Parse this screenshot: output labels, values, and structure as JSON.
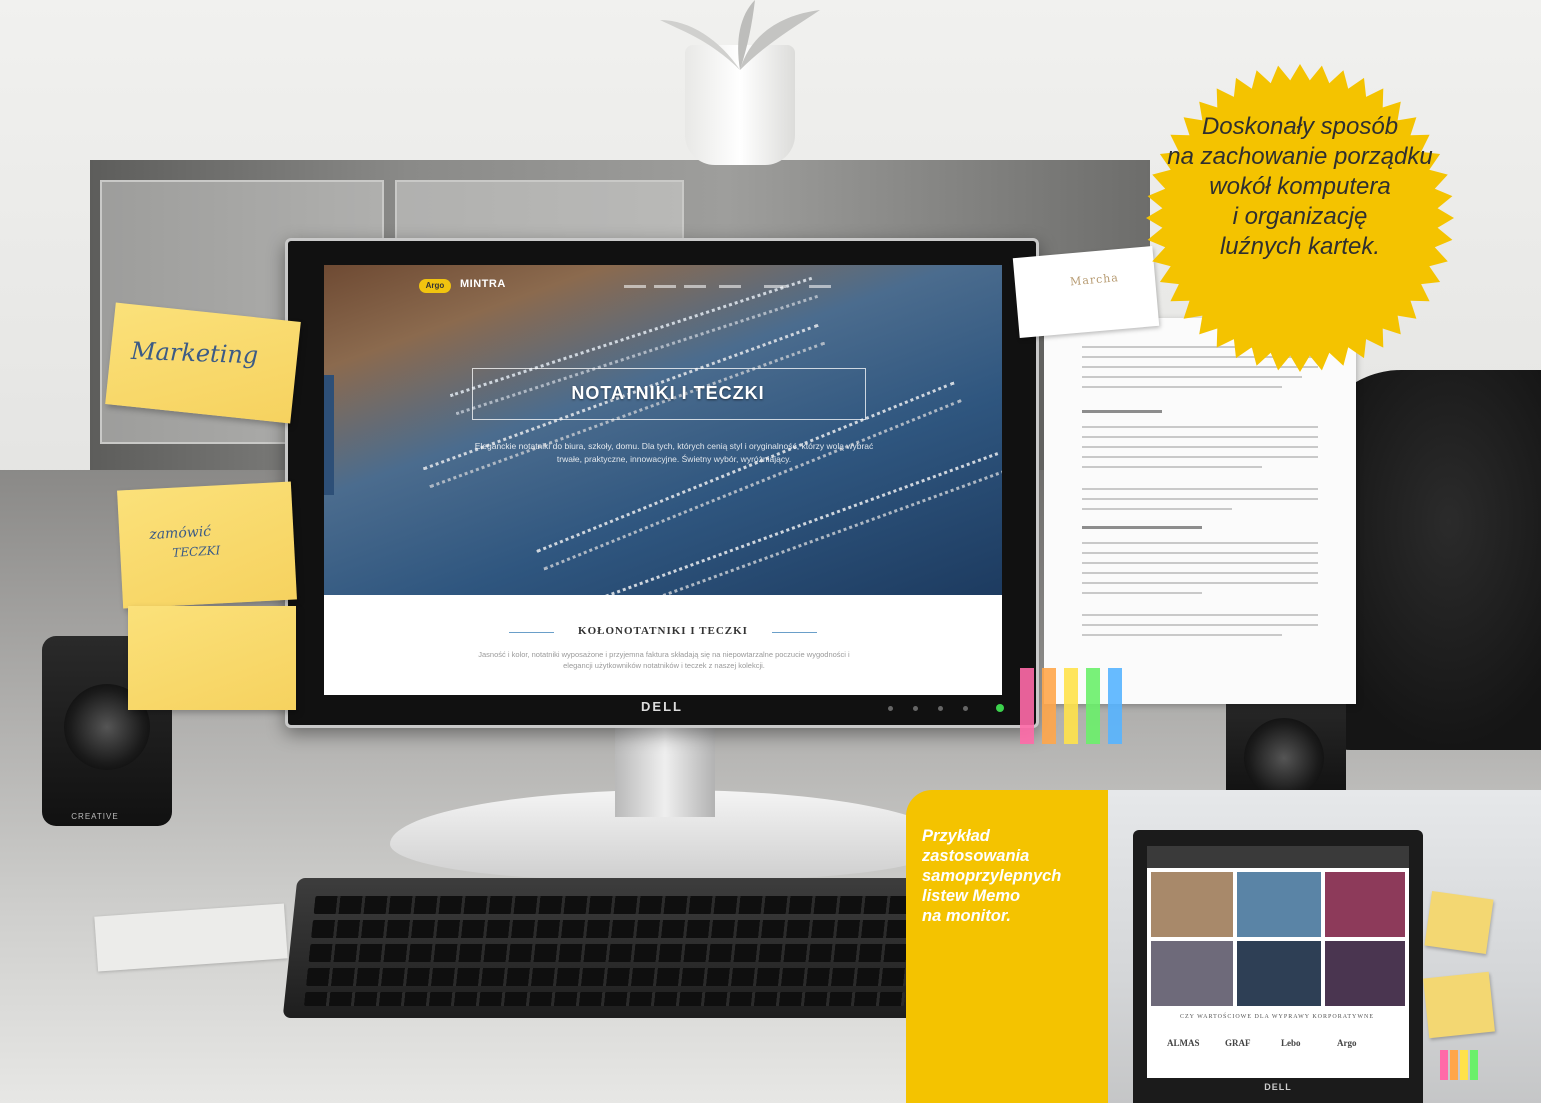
{
  "headline": {
    "lines": [
      "Doskonały sposób",
      "na zachowanie porządku",
      "wokół komputera",
      "i organizację",
      "luźnych kartek."
    ]
  },
  "caption": {
    "lines": [
      "Przykład",
      "zastosowania",
      "samoprzylepnych",
      "listew Memo",
      "na monitor."
    ]
  },
  "sticky_notes": {
    "top": "Marketing",
    "middle_line1": "zamówić",
    "middle_line2": "TECZKI"
  },
  "website": {
    "logo_badge": "Argo",
    "logo_text": "MINTRA",
    "hero_title": "NOTATNIKI I TECZKI",
    "hero_subtitle_line1": "Eleganckie notatniki do biura, szkoły, domu. Dla tych, których cenią styl i oryginalność, którzy wolą wybrać",
    "hero_subtitle_line2": "trwałe, praktyczne, innowacyjne. Świetny wybór, wyróżniający.",
    "section_title": "KOŁONOTATNIKI I TECZKI",
    "section_text_line1": "Jasność i kolor, notatniki wyposażone i przyjemna faktura składają się na niepowtarzalne poczucie wygodności i",
    "section_text_line2": "elegancji użytkowników notatników i teczek z naszej kolekcji."
  },
  "monitor": {
    "brand": "DELL"
  },
  "business_card": {
    "text": "Marcha"
  },
  "speaker": {
    "brand": "CREATIVE"
  },
  "mini_screen": {
    "caption": "CZY WARTOŚCIOWE DLA WYPRAWY KORPORATYWNE",
    "logos": [
      "ALMAS",
      "GRAF",
      "Lebo",
      "Argo"
    ],
    "brand": "DELL"
  },
  "colors": {
    "accent_yellow": "#f4c300",
    "sticky_yellow": "#f6d25f",
    "memo_tabs": [
      "#ff6aa8",
      "#ffa64a",
      "#ffe24a",
      "#6af06a",
      "#56b4ff"
    ]
  }
}
